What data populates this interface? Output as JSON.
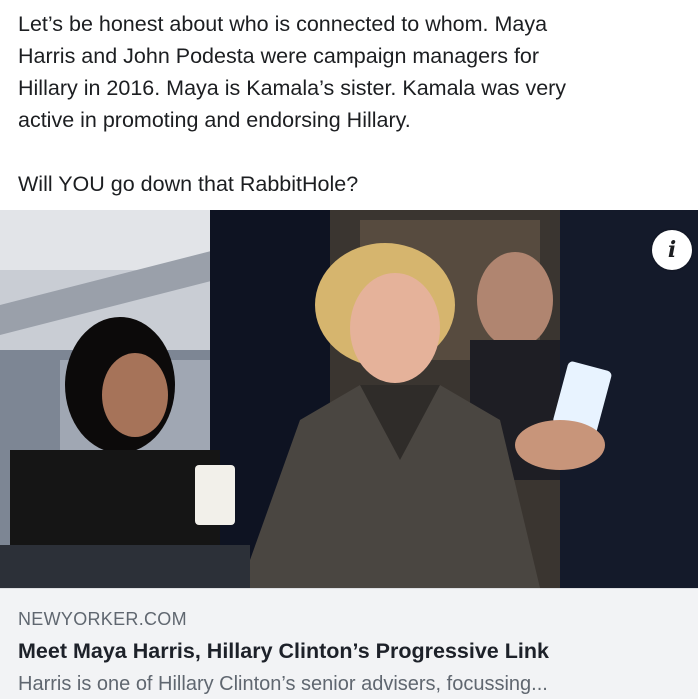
{
  "post": {
    "lines": [
      "Let’s be honest about who is connected to whom.  Maya",
      "Harris and John Podesta were campaign managers for",
      "Hillary in 2016.  Maya is Kamala’s sister.  Kamala was very",
      "active in promoting and endorsing Hillary."
    ],
    "question": "Will YOU go down that RabbitHole?"
  },
  "link_card": {
    "info_icon": "info-icon",
    "domain": "NEWYORKER.COM",
    "title": "Meet Maya Harris, Hillary Clinton’s Progressive Link",
    "description": "Harris is one of Hillary Clinton’s senior advisers, focussing..."
  },
  "colors": {
    "text": "#1c1e21",
    "meta_bg": "#f2f3f5",
    "secondary_text": "#606770"
  }
}
